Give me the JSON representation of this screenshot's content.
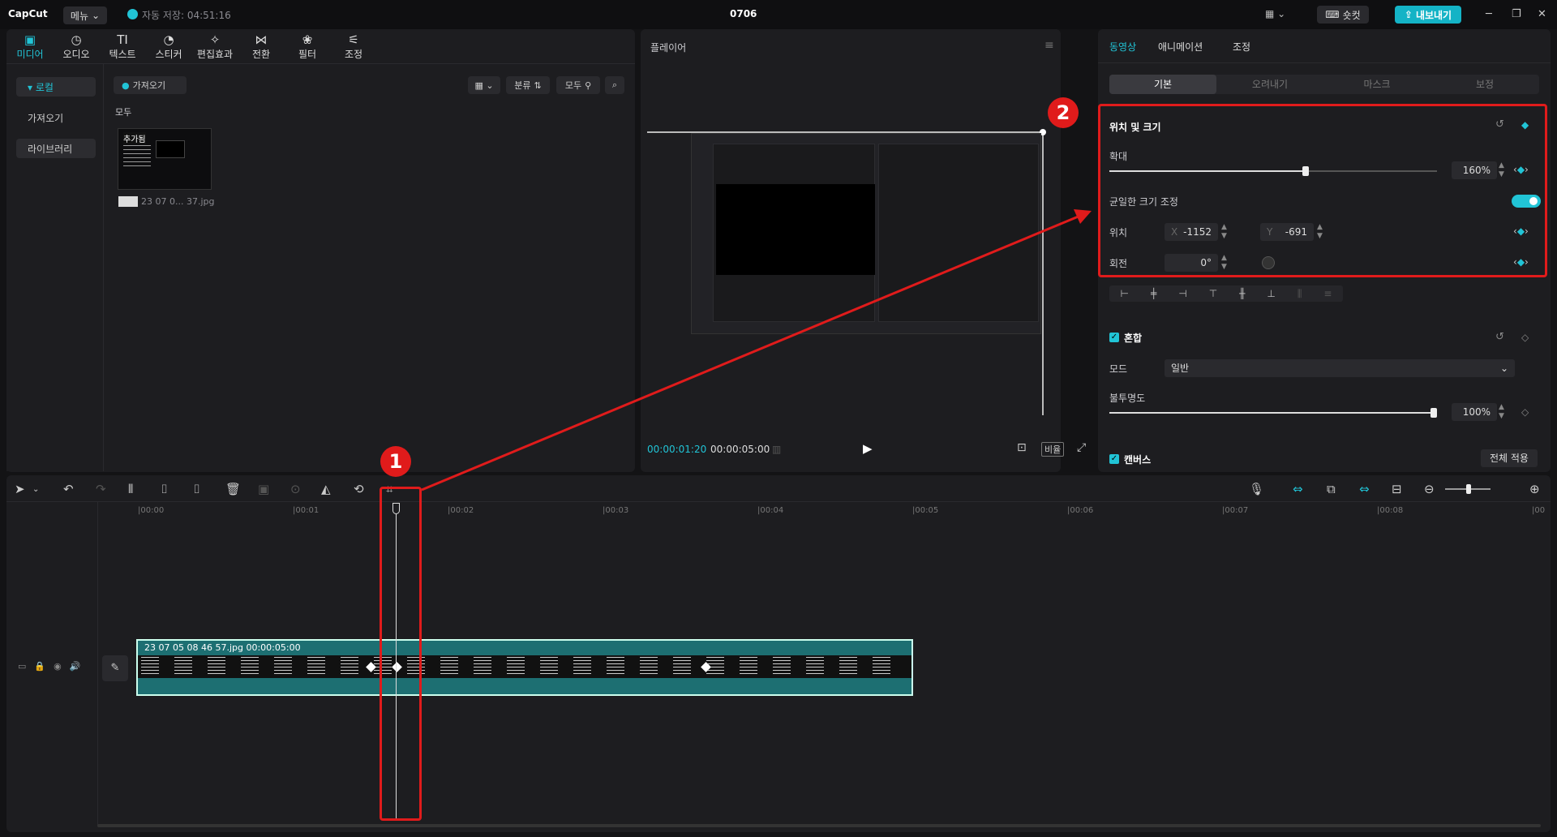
{
  "titlebar": {
    "logo": "CapCut",
    "menu": "메뉴",
    "autosave": "자동 저장: 04:51:16",
    "project": "0706",
    "shortcut": "숏컷",
    "export": "내보내기",
    "minimize": "─",
    "maximize": "❐",
    "close": "✕"
  },
  "toolbar": [
    {
      "label": "미디어",
      "icon": "media-icon",
      "glyph": "▣"
    },
    {
      "label": "오디오",
      "icon": "audio-icon",
      "glyph": "◷"
    },
    {
      "label": "텍스트",
      "icon": "text-icon",
      "glyph": "TI"
    },
    {
      "label": "스티커",
      "icon": "sticker-icon",
      "glyph": "◔"
    },
    {
      "label": "편집효과",
      "icon": "effects-icon",
      "glyph": "✧"
    },
    {
      "label": "전환",
      "icon": "transition-icon",
      "glyph": "⋈"
    },
    {
      "label": "필터",
      "icon": "filter-icon",
      "glyph": "❀"
    },
    {
      "label": "조정",
      "icon": "adjust-icon",
      "glyph": "⚟"
    }
  ],
  "sidebar": {
    "local": "▾ 로컬",
    "import": "가져오기",
    "library": "라이브러리"
  },
  "media": {
    "import_btn": "가져오기",
    "sort": "분류",
    "all": "모두",
    "section": "모두",
    "thumb_badge": "추가됨",
    "file_name": "23 07 0... 37.jpg"
  },
  "player": {
    "title": "플레이어",
    "current_time": "00:00:01:20",
    "total_time": "00:00:05:00",
    "ratio": "비율"
  },
  "props": {
    "tabs": [
      "동영상",
      "애니메이션",
      "조정"
    ],
    "subtabs": [
      "기본",
      "오려내기",
      "마스크",
      "보정"
    ],
    "pos_size_title": "위치 및 크기",
    "scale_label": "확대",
    "scale_value": "160%",
    "scale_fraction": 0.6,
    "uniform_label": "균일한 크기 조정",
    "pos_label": "위치",
    "x_label": "X",
    "x_value": "-1152",
    "y_label": "Y",
    "y_value": "-691",
    "rot_label": "회전",
    "rot_value": "0°",
    "blend_title": "혼합",
    "mode_label": "모드",
    "mode_value": "일반",
    "opacity_label": "불투명도",
    "opacity_value": "100%",
    "opacity_fraction": 1.0,
    "canvas_title": "캔버스",
    "apply_all": "전체 적용"
  },
  "timeline": {
    "ruler": [
      "00:00",
      "00:01",
      "00:02",
      "00:03",
      "00:04",
      "00:05",
      "00:06",
      "00:07",
      "00:08",
      "00"
    ],
    "clip_label": "23 07 05 08 46 57.jpg  00:00:05:00"
  },
  "annotations": {
    "badge1": "1",
    "badge2": "2"
  },
  "colors": {
    "accent": "#21c4d6",
    "annotation": "#e01b1b",
    "clip": "#1d6f72"
  }
}
